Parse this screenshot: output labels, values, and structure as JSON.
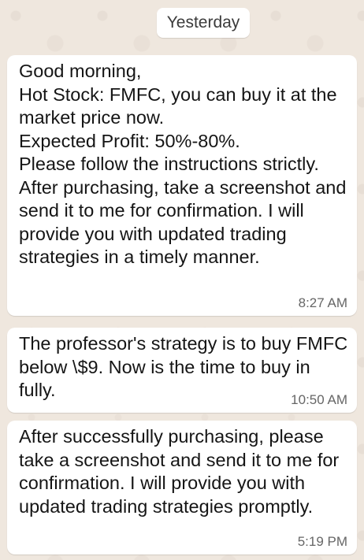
{
  "date_chip": "Yesterday",
  "messages": [
    {
      "text": "Good morning,\nHot Stock: FMFC, you can buy it at the market price now.\nExpected Profit: 50%-80%.\nPlease follow the instructions strictly. After purchasing, take a screenshot and send it to me for confirmation. I will provide you with updated trading strategies in a timely manner.",
      "time": "8:27 AM"
    },
    {
      "text": "The professor's strategy is to buy FMFC below \\$9. Now is the time to buy in fully.",
      "time": "10:50 AM"
    },
    {
      "text": "After successfully purchasing, please take a screenshot and send it to me for confirmation. I will provide you with updated trading strategies promptly.",
      "time": "5:19 PM"
    }
  ]
}
